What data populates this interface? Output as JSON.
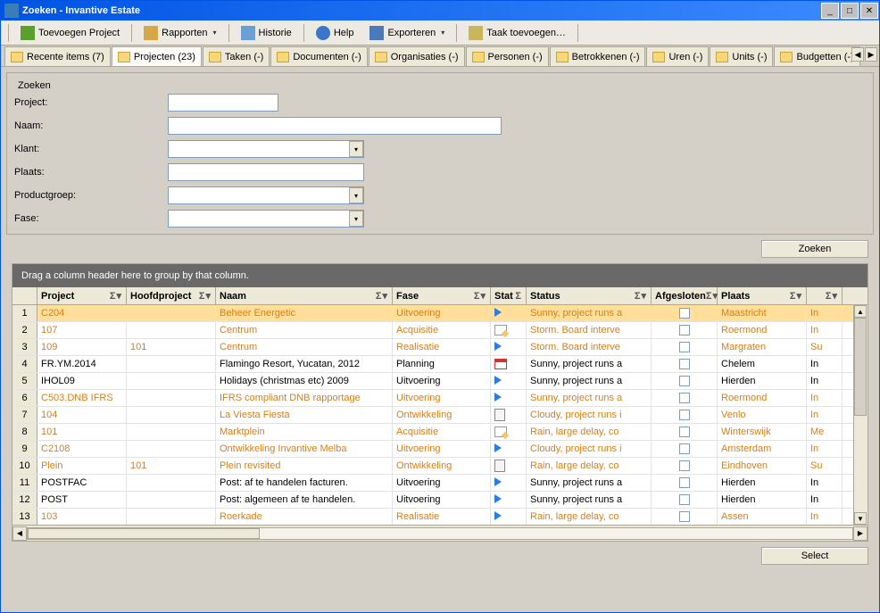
{
  "window": {
    "title": "Zoeken - Invantive Estate"
  },
  "toolbar": {
    "add_project": "Toevoegen Project",
    "reports": "Rapporten",
    "history": "Historie",
    "help": "Help",
    "export": "Exporteren",
    "add_task": "Taak toevoegen…"
  },
  "tabs": [
    {
      "label": "Recente items (7)"
    },
    {
      "label": "Projecten (23)",
      "active": true
    },
    {
      "label": "Taken (-)"
    },
    {
      "label": "Documenten (-)"
    },
    {
      "label": "Organisaties (-)"
    },
    {
      "label": "Personen (-)"
    },
    {
      "label": "Betrokkenen (-)"
    },
    {
      "label": "Uren (-)"
    },
    {
      "label": "Units (-)"
    },
    {
      "label": "Budgetten (-)"
    }
  ],
  "search_form": {
    "legend": "Zoeken",
    "labels": {
      "project": "Project:",
      "naam": "Naam:",
      "klant": "Klant:",
      "plaats": "Plaats:",
      "productgroep": "Productgroep:",
      "fase": "Fase:"
    },
    "values": {
      "project": "",
      "naam": "",
      "klant": "",
      "plaats": "",
      "productgroep": "",
      "fase": ""
    },
    "zoeken_btn": "Zoeken"
  },
  "grid": {
    "group_hint": "Drag a column header here to group by that column.",
    "columns": {
      "project": "Project",
      "hoofd": "Hoofdproject",
      "naam": "Naam",
      "fase": "Fase",
      "stat": "Stat",
      "status": "Status",
      "afg": "Afgesloten",
      "plaats": "Plaats"
    },
    "sigma": "Σ",
    "filter": "▾",
    "rows": [
      {
        "n": "1",
        "project": "C204",
        "hoofd": "",
        "naam": "Beheer Energetic",
        "fase": "Uitvoering",
        "icon": "play",
        "status": "Sunny, project runs a",
        "plaats": "Maastricht",
        "last": "In",
        "hl": true,
        "sel": true
      },
      {
        "n": "2",
        "project": "107",
        "hoofd": "",
        "naam": "Centrum",
        "fase": "Acquisitie",
        "icon": "edit",
        "status": "Storm. Board interve",
        "plaats": "Roermond",
        "last": "In",
        "hl": true
      },
      {
        "n": "3",
        "project": "109",
        "hoofd": "101",
        "naam": "Centrum",
        "fase": "Realisatie",
        "icon": "play",
        "status": "Storm. Board interve",
        "plaats": "Margraten",
        "last": "Su",
        "hl": true
      },
      {
        "n": "4",
        "project": "FR.YM.2014",
        "hoofd": "",
        "naam": "Flamingo Resort, Yucatan, 2012",
        "fase": "Planning",
        "icon": "cal",
        "status": "Sunny, project runs a",
        "plaats": "Chelem",
        "last": "In"
      },
      {
        "n": "5",
        "project": "IHOL09",
        "hoofd": "",
        "naam": "Holidays (christmas etc) 2009",
        "fase": "Uitvoering",
        "icon": "play",
        "status": "Sunny, project runs a",
        "plaats": "Hierden",
        "last": "In"
      },
      {
        "n": "6",
        "project": "C503.DNB IFRS",
        "hoofd": "",
        "naam": "IFRS compliant DNB rapportage",
        "fase": "Uitvoering",
        "icon": "play",
        "status": "Sunny, project runs a",
        "plaats": "Roermond",
        "last": "In",
        "hl": true
      },
      {
        "n": "7",
        "project": "104",
        "hoofd": "",
        "naam": "La Viesta Fiesta",
        "fase": "Ontwikkeling",
        "icon": "doc",
        "status": "Cloudy, project runs i",
        "plaats": "Venlo",
        "last": "In",
        "hl": true
      },
      {
        "n": "8",
        "project": "101",
        "hoofd": "",
        "naam": "Marktplein",
        "fase": "Acquisitie",
        "icon": "edit",
        "status": "Rain, large delay, co",
        "plaats": "Winterswijk",
        "last": "Me",
        "hl": true
      },
      {
        "n": "9",
        "project": "C2108",
        "hoofd": "",
        "naam": "Ontwikkeling Invantive Melba",
        "fase": "Uitvoering",
        "icon": "play",
        "status": "Cloudy, project runs i",
        "plaats": "Amsterdam",
        "last": "In",
        "hl": true
      },
      {
        "n": "10",
        "project": "Plein",
        "hoofd": "101",
        "naam": "Plein revisited",
        "fase": "Ontwikkeling",
        "icon": "doc",
        "status": "Rain, large delay, co",
        "plaats": "Eindhoven",
        "last": "Su",
        "hl": true
      },
      {
        "n": "11",
        "project": "POSTFAC",
        "hoofd": "",
        "naam": "Post: af te handelen facturen.",
        "fase": "Uitvoering",
        "icon": "play",
        "status": "Sunny, project runs a",
        "plaats": "Hierden",
        "last": "In"
      },
      {
        "n": "12",
        "project": "POST",
        "hoofd": "",
        "naam": "Post: algemeen af te handelen.",
        "fase": "Uitvoering",
        "icon": "play",
        "status": "Sunny, project runs a",
        "plaats": "Hierden",
        "last": "In"
      },
      {
        "n": "13",
        "project": "103",
        "hoofd": "",
        "naam": "Roerkade",
        "fase": "Realisatie",
        "icon": "play",
        "status": "Rain, large delay, co",
        "plaats": "Assen",
        "last": "In",
        "hl": true
      }
    ]
  },
  "footer": {
    "select_btn": "Select"
  }
}
